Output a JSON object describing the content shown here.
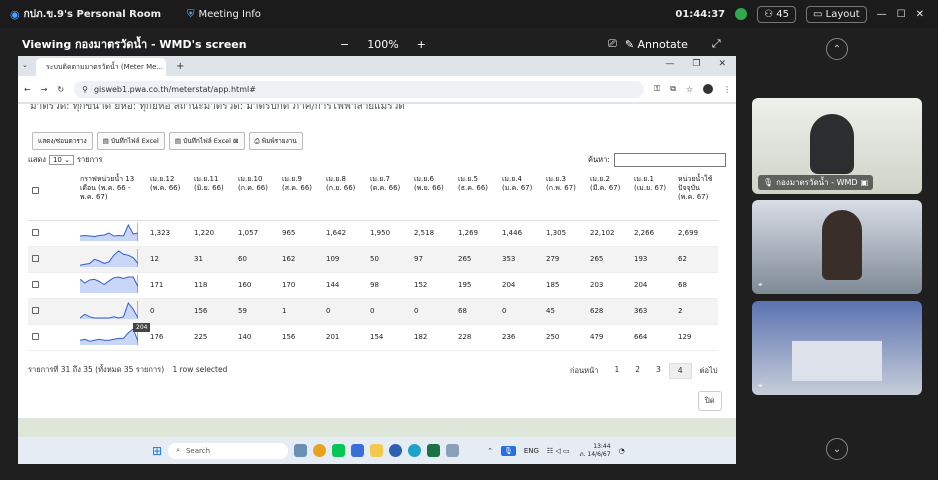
{
  "topbar": {
    "room_title": "กปภ.ข.9's Personal Room",
    "meeting_info": "Meeting Info",
    "time": "01:44:37",
    "participants": "45",
    "layout": "Layout"
  },
  "viewbar": {
    "title": "Viewing กองมาตรวัดน้ำ - WMD's screen",
    "zoom_minus": "−",
    "zoom": "100%",
    "zoom_plus": "+",
    "annotate": "Annotate"
  },
  "browser": {
    "tab_title": "ระบบติดตามมาตรวัดน้ำ (Meter Me...",
    "url": "gisweb1.pwa.co.th/meterstat/app.html#",
    "new_tab": "+"
  },
  "modal": {
    "header": "มาตรวัด: ทุกขนาด ยี่ห้อ: ทุกยี่ห้อ สถานะมาตรวัด: มาตรปกติ ภาค/การไฟฟ้าสายแมรวัด",
    "buttons": [
      "แสดง/ซ่อนตาราง",
      "บันทึกไฟล์ Excel",
      "บันทึกไฟล์ Excel ⊠",
      "พิมพ์รายงาน"
    ],
    "show_label": "แสดง",
    "page_len": "10",
    "records_label": "รายการ",
    "search_label": "ค้นหา:",
    "columns": [
      "กราฟหน่วยน้ำ 13 เดือน (พ.ค. 66 - พ.ค. 67)",
      "เม.ย.12 (พ.ค. 66)",
      "เม.ย.11 (มิ.ย. 66)",
      "เม.ย.10 (ก.ค. 66)",
      "เม.ย.9 (ส.ค. 66)",
      "เม.ย.8 (ก.ย. 66)",
      "เม.ย.7 (ต.ค. 66)",
      "เม.ย.6 (พ.ย. 66)",
      "เม.ย.5 (ธ.ค. 66)",
      "เม.ย.4 (ม.ค. 67)",
      "เม.ย.3 (ก.พ. 67)",
      "เม.ย.2 (มี.ค. 67)",
      "เม.ย.1 (เม.ย. 67)",
      "หน่วยน้ำใช้ปัจจุบัน (พ.ค. 67)"
    ],
    "rows": [
      {
        "values": [
          "1,323",
          "1,220",
          "1,057",
          "965",
          "1,642",
          "1,950",
          "2,518",
          "1,269",
          "1,446",
          "1,305",
          "22,102",
          "2,266",
          "2,699"
        ],
        "spark": [
          8,
          9,
          8,
          7,
          9,
          10,
          14,
          8,
          9,
          8,
          30,
          12,
          14
        ]
      },
      {
        "values": [
          "12",
          "31",
          "60",
          "162",
          "109",
          "50",
          "97",
          "265",
          "353",
          "279",
          "265",
          "193",
          "62"
        ],
        "spark": [
          1,
          2,
          3,
          8,
          6,
          3,
          5,
          13,
          18,
          14,
          13,
          10,
          3
        ]
      },
      {
        "values": [
          "171",
          "118",
          "160",
          "170",
          "144",
          "98",
          "152",
          "195",
          "204",
          "185",
          "203",
          "204",
          "68"
        ],
        "spark": [
          17,
          12,
          16,
          17,
          14,
          10,
          15,
          19,
          20,
          18,
          20,
          20,
          7
        ]
      },
      {
        "values": [
          "0",
          "156",
          "59",
          "1",
          "0",
          "0",
          "0",
          "68",
          "0",
          "45",
          "628",
          "363",
          "2"
        ],
        "spark": [
          0,
          3,
          1,
          0,
          0,
          0,
          0,
          1,
          0,
          1,
          12,
          7,
          0
        ]
      },
      {
        "values": [
          "176",
          "225",
          "140",
          "156",
          "201",
          "154",
          "182",
          "228",
          "236",
          "250",
          "479",
          "664",
          "129"
        ],
        "spark": [
          4,
          5,
          3,
          4,
          5,
          4,
          4,
          5,
          6,
          6,
          12,
          16,
          3
        ]
      }
    ],
    "tooltip": "204",
    "info": "รายการที่ 31 ถึง 35 (ทั้งหมด 35 รายการ)",
    "selected": "1 row selected",
    "prev": "ก่อนหน้า",
    "pages": [
      "1",
      "2",
      "3",
      "4"
    ],
    "next": "ต่อไป",
    "close": "ปิด"
  },
  "taskbar": {
    "search": "Search",
    "lang": "ENG",
    "clock_time": "13:44",
    "clock_date": "ภ. 14/6/67"
  },
  "side": {
    "video1_name": "กองมาตรวัดน้ำ - WMD",
    "participant_count": "45"
  },
  "colors": {
    "spark": "#2f5fd0",
    "spark_fill": "#c9d6f5",
    "accent_red": "#e23a3a"
  }
}
